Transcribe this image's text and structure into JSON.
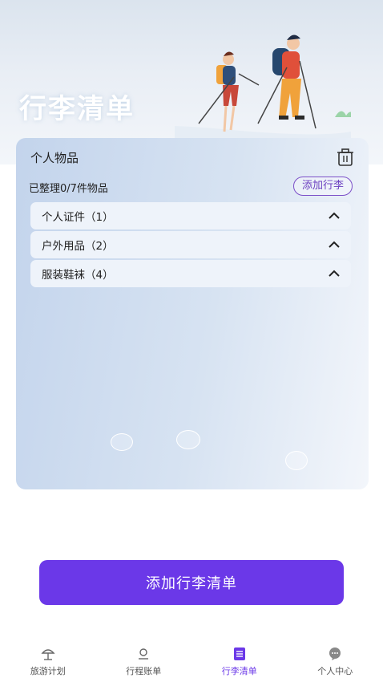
{
  "hero": {
    "title": "行李清单"
  },
  "card": {
    "title": "个人物品",
    "summary": "已整理0/7件物品",
    "add_label": "添加行李",
    "categories": [
      {
        "label": "个人证件（1）"
      },
      {
        "label": "户外用品（2）"
      },
      {
        "label": "服装鞋袜（4）"
      }
    ]
  },
  "main_button": {
    "label": "添加行李清单"
  },
  "tabs": [
    {
      "label": "旅游计划",
      "icon": "beach-umbrella-icon"
    },
    {
      "label": "行程账单",
      "icon": "location-pin-icon"
    },
    {
      "label": "行李清单",
      "icon": "list-icon",
      "active": true
    },
    {
      "label": "个人中心",
      "icon": "chat-bubble-icon"
    }
  ],
  "colors": {
    "accent": "#6b38e8",
    "accent_border": "#7b4ec8"
  }
}
